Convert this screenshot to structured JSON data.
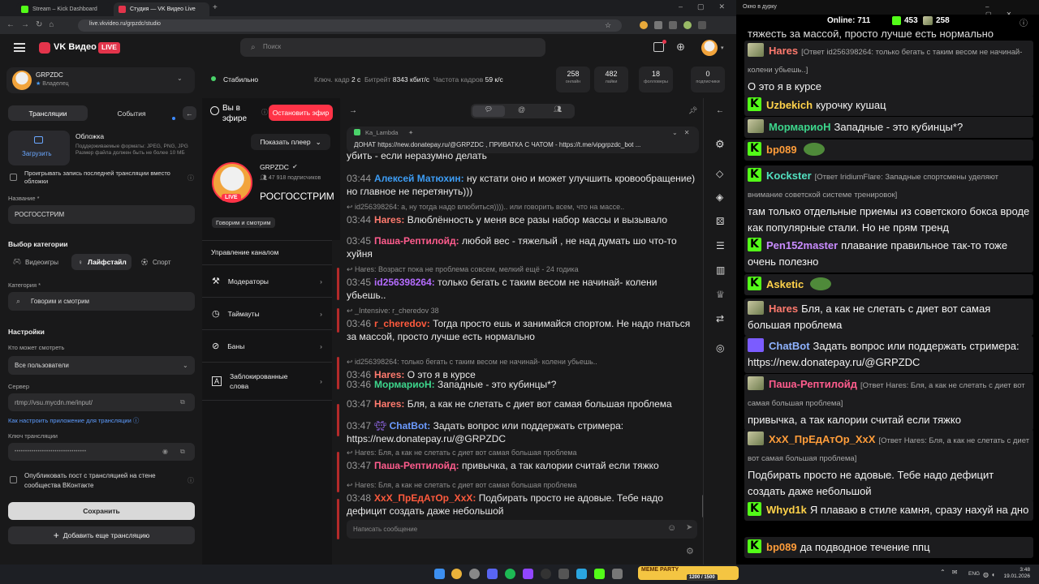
{
  "browser": {
    "tabs": [
      {
        "label": "Stream – Kick Dashboard",
        "color": "#53fc18"
      },
      {
        "label": "Студия — VK Видео Live",
        "color": "#e3344b"
      }
    ],
    "url": "live.vkvideo.ru/grpzdc/studio"
  },
  "header": {
    "logo": "VK Видео",
    "live_badge": "LIVE",
    "search_placeholder": "Поиск"
  },
  "channel": {
    "name": "GRPZDC",
    "role": "Владелец"
  },
  "sidebar": {
    "tab_streams": "Трансляции",
    "tab_events": "События",
    "cover_title": "Обложка",
    "upload_label": "Загрузить",
    "cover_hint": "Поддерживаемые форматы: JPEG, PNG, JPG Размер файла должен быть не более 10 МБ",
    "replay_checkbox": "Проигрывать запись последней трансляции вместо обложки",
    "name_label": "Название *",
    "name_value": "РОСГОССТРИМ",
    "category_section": "Выбор категории",
    "cat_tabs": [
      "Видеоигры",
      "Лайфстайл",
      "Спорт"
    ],
    "category_label": "Категория *",
    "category_value": "Говорим и смотрим",
    "settings_section": "Настройки",
    "who_label": "Кто может смотреть",
    "who_value": "Все пользователи",
    "server_label": "Сервер",
    "server_value": "rtmp://vsu.mycdn.me/input/",
    "setup_link": "Как настроить приложение для трансляции",
    "key_label": "Ключ трансляции",
    "key_value": "••••••••••••••••••••••••••••••••••",
    "publish_checkbox": "Опубликовать пост с трансляцией на стене сообщества ВКонтакте",
    "save_button": "Сохранить",
    "add_button": "Добавить еще трансляцию"
  },
  "status": {
    "state": "Стабильно",
    "keyframe_label": "Ключ. кадр",
    "keyframe_value": "2 с",
    "bitrate_label": "Битрейт",
    "bitrate_value": "8343 кбит/с",
    "fps_label": "Частота кадров",
    "fps_value": "59 к/с",
    "stats": [
      {
        "n": "258",
        "t": "онлайн"
      },
      {
        "n": "482",
        "t": "лайки"
      },
      {
        "n": "18",
        "t": "фолловеры"
      },
      {
        "n": "0",
        "t": "подписчики"
      }
    ]
  },
  "live": {
    "on_air": "Вы в эфире",
    "stop_button": "Остановить эфир",
    "show_player": "Показать плеер",
    "channel_name": "GRPZDC",
    "subscribers": "47 918 подписчиков",
    "stream_title": "РОСГОССТРИМ",
    "live_badge": "LIVE",
    "category_tag": "Говорим и смотрим",
    "manage_title": "Управление каналом",
    "menu": [
      "Модераторы",
      "Таймауты",
      "Баны",
      "Заблокированные слова"
    ]
  },
  "chat": {
    "pinned_user": "Ka_Lambda",
    "pinned_text": "ДОНАТ https://new.donatepay.ru/@GRPZDC , ПРИВАТКА С ЧАТОМ - https://t.me/vipgrpzdc_bot ...",
    "input_placeholder": "Написать сообщение",
    "messages": [
      {
        "time": "",
        "user": "",
        "color": "#e9e9e9",
        "text": "убить - если неразумно делать",
        "reply": ""
      },
      {
        "time": "03:44",
        "user": "Алексей Матюхин:",
        "color": "#3d9df5",
        "text": "ну кстати оно и может улучшить кровообращение) но главное не перетянуть)))",
        "reply": ""
      },
      {
        "time": "03:44",
        "user": "Hares:",
        "color": "#ff7a6e",
        "text": "Влюблённость у меня все разы набор массы и вызывало",
        "reply": "id256398264: а, ну тогда надо влюбиться)))).. или говорить всем, что на массе.."
      },
      {
        "time": "03:45",
        "user": "Паша-Рептилойд:",
        "color": "#ff5c8d",
        "text": "любой вес - тяжелый , не над думать шо что-то хуйня",
        "reply": ""
      },
      {
        "time": "03:45",
        "user": "id256398264:",
        "color": "#b56cff",
        "text": "только бегать с таким весом не начинай- колени убьешь..",
        "reply": "Hares: Возраст пока не проблема совсем, мелкий ещё - 24 годика"
      },
      {
        "time": "03:46",
        "user": "r_cheredov:",
        "color": "#ff5a3d",
        "text": "Тогда просто ешь и занимайся спортом. Не надо гнаться за массой, просто лучше есть нормально",
        "reply": "_Intensive: r_cheredov 38"
      },
      {
        "time": "03:46",
        "user": "Hares:",
        "color": "#ff7a6e",
        "text": "О это я в курсе",
        "reply": "id256398264: только бегать с таким весом не начинай- колени убьешь.."
      },
      {
        "time": "03:46",
        "user": "МормариоН:",
        "color": "#3dd68c",
        "text": "Западные - это кубинцы*?",
        "reply": ""
      },
      {
        "time": "03:47",
        "user": "Hares:",
        "color": "#ff7a6e",
        "text": "Бля, а как не слетать с диет вот самая большая проблема",
        "reply": ""
      },
      {
        "time": "03:47",
        "user": "ChatBot:",
        "color": "#6c9bff",
        "text": "Задать вопрос или поддержать стримера: https://new.donatepay.ru/@GRPZDC",
        "reply": ""
      },
      {
        "time": "03:47",
        "user": "Паша-Рептилойд:",
        "color": "#ff5c8d",
        "text": "привычка, а так калории считай если тяжко",
        "reply": "Hares: Бля, а как не слетать с диет вот самая большая проблема"
      },
      {
        "time": "03:48",
        "user": "XxX_ПрЕдАтОр_XxX:",
        "color": "#ff5a3d",
        "text": "Подбирать просто не адовые. Тебе надо дефицит создать даже небольшой",
        "reply": "Hares: Бля, а как не слетать с диет вот самая большая проблема"
      }
    ]
  },
  "overlay": {
    "title": "Окно в дурку",
    "online_label": "Online:",
    "online_value": "711",
    "kick_count": "453",
    "vk_count": "258",
    "top_cut": "тяжесть за массой, просто лучше есть нормально",
    "messages": [
      {
        "icon": "avatar",
        "user": "Hares",
        "color": "#ff7a6e",
        "reply": "[Ответ id256398264: только бегать с таким весом не начинай- колени убьешь..]",
        "text": "О это я в курсе"
      },
      {
        "icon": "kick",
        "user": "Uzbekich",
        "color": "#ffd24a",
        "reply": "",
        "text": "курочку кушац"
      },
      {
        "icon": "avatar",
        "user": "МормариоН",
        "color": "#3dd68c",
        "reply": "",
        "text": "Западные - это кубинцы*?"
      },
      {
        "icon": "kick",
        "user": "bp089",
        "color": "#ff9d3a",
        "reply": "",
        "text": ""
      },
      {
        "icon": "kick",
        "user": "Kockster",
        "color": "#53e0c0",
        "reply": "[Ответ IridiumFlare: Западные спортсмены уделяют внимание советской системе тренировок]",
        "text": "там только отдельные приемы из советского бокса вроде как популярные стали. Но не прям тренд"
      },
      {
        "icon": "kick",
        "user": "Pen152master",
        "color": "#c98cff",
        "reply": "",
        "text": "плавание правильное так-то тоже очень полезно"
      },
      {
        "icon": "kick",
        "user": "Asketic",
        "color": "#ffd24a",
        "reply": "",
        "text": ""
      },
      {
        "icon": "avatar",
        "user": "Hares",
        "color": "#ff7a6e",
        "reply": "",
        "text": "Бля, а как не слетать с диет вот самая большая проблема"
      },
      {
        "icon": "bot",
        "user": "ChatBot",
        "color": "#8fb3ff",
        "reply": "",
        "text": "Задать вопрос или поддержать стримера: https://new.donatepay.ru/@GRPZDC"
      },
      {
        "icon": "avatar",
        "user": "Паша-Рептилойд",
        "color": "#ff5c8d",
        "reply": "[Ответ Hares: Бля, а как не слетать с диет вот самая большая проблема]",
        "text": "привычка, а так калории считай если тяжко"
      },
      {
        "icon": "avatar",
        "user": "XxX_ПрЕдАтОр_XxX",
        "color": "#ff9d3a",
        "reply": "[Ответ Hares: Бля, а как не слетать с диет вот самая большая проблема]",
        "text": "Подбирать просто не адовые. Тебе надо дефицит создать даже небольшой"
      },
      {
        "icon": "kick",
        "user": "Whyd1k",
        "color": "#ffd24a",
        "reply": "",
        "text": "Я плаваю в стиле камня, сразу нахуй на дно"
      },
      {
        "icon": "kick",
        "user": "bp089",
        "color": "#ff9d3a",
        "reply": "",
        "text": "да подводное течение ппц"
      }
    ]
  },
  "taskbar": {
    "lang": "ENG",
    "time": "3:48",
    "date": "19.01.2026",
    "widget": "MEME PARTY",
    "widget_count": "1200 / 1500"
  }
}
